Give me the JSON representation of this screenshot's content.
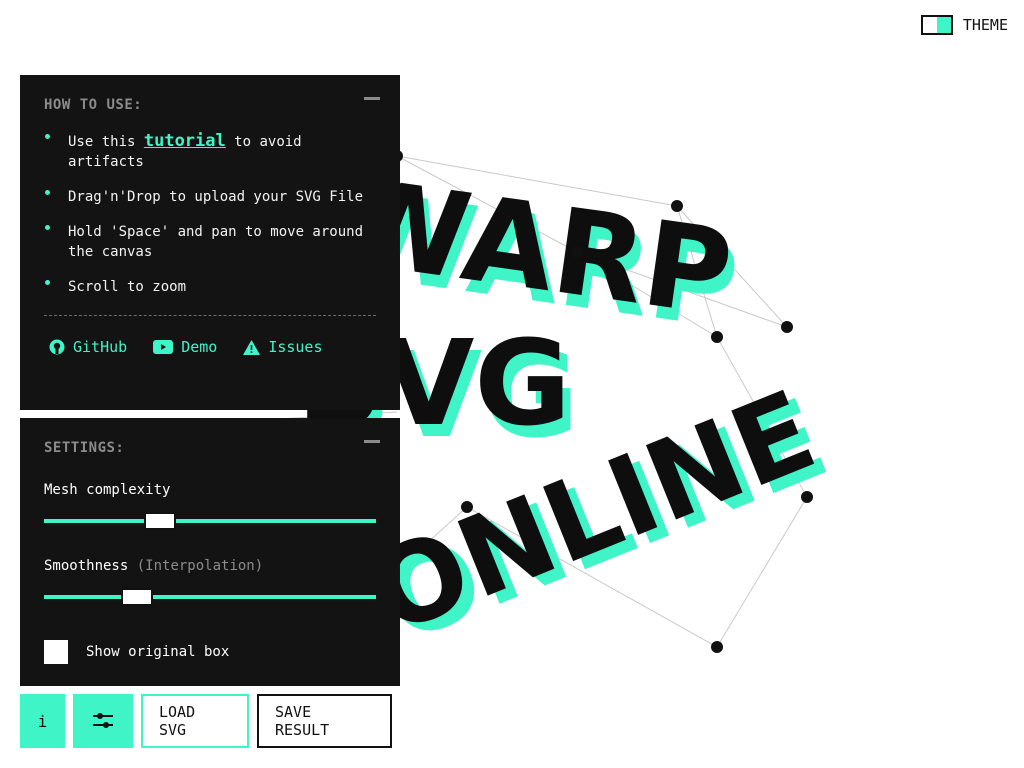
{
  "theme": {
    "label": "THEME"
  },
  "canvas": {
    "words": [
      "WARP",
      "SVG",
      "ONLINE"
    ],
    "accent": "#3ff5c8",
    "ink": "#0e0e0e"
  },
  "how_to": {
    "title": "HOW TO USE:",
    "items": [
      {
        "pre": "Use this ",
        "link": "tutorial",
        "post": " to avoid artifacts"
      },
      {
        "text": "Drag'n'Drop to upload your SVG File"
      },
      {
        "text": "Hold 'Space' and pan to move around the canvas"
      },
      {
        "text": "Scroll to zoom"
      }
    ],
    "links": [
      {
        "label": "GitHub",
        "icon": "github-icon"
      },
      {
        "label": "Demo",
        "icon": "youtube-icon"
      },
      {
        "label": "Issues",
        "icon": "warning-icon"
      }
    ]
  },
  "settings": {
    "title": "SETTINGS:",
    "mesh": {
      "label": "Mesh complexity",
      "value": 0.35
    },
    "smooth": {
      "label": "Smoothness",
      "hint": "(Interpolation)",
      "value": 0.28
    },
    "show_box": {
      "label": "Show original box",
      "checked": false
    }
  },
  "toolbar": {
    "info": "i",
    "load": "LOAD SVG",
    "save": "SAVE RESULT"
  },
  "colors": {
    "accent": "#3ff5c8",
    "panel": "#131313",
    "muted": "#8b8b8b"
  }
}
